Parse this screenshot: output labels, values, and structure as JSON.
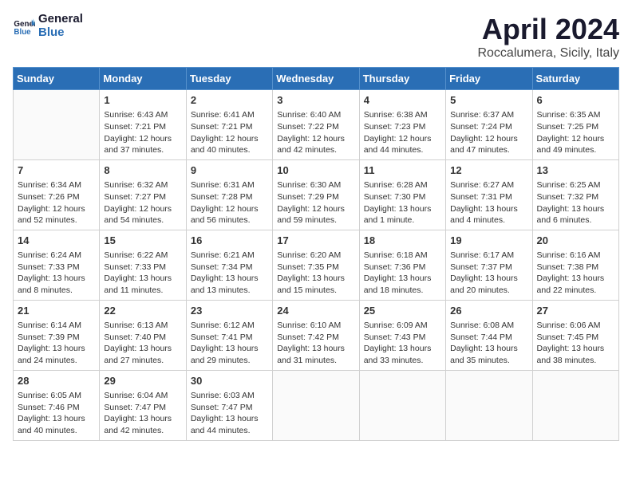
{
  "header": {
    "logo_line1": "General",
    "logo_line2": "Blue",
    "title": "April 2024",
    "subtitle": "Roccalumera, Sicily, Italy"
  },
  "columns": [
    "Sunday",
    "Monday",
    "Tuesday",
    "Wednesday",
    "Thursday",
    "Friday",
    "Saturday"
  ],
  "weeks": [
    [
      {
        "day": "",
        "sunrise": "",
        "sunset": "",
        "daylight": ""
      },
      {
        "day": "1",
        "sunrise": "Sunrise: 6:43 AM",
        "sunset": "Sunset: 7:21 PM",
        "daylight": "Daylight: 12 hours and 37 minutes."
      },
      {
        "day": "2",
        "sunrise": "Sunrise: 6:41 AM",
        "sunset": "Sunset: 7:21 PM",
        "daylight": "Daylight: 12 hours and 40 minutes."
      },
      {
        "day": "3",
        "sunrise": "Sunrise: 6:40 AM",
        "sunset": "Sunset: 7:22 PM",
        "daylight": "Daylight: 12 hours and 42 minutes."
      },
      {
        "day": "4",
        "sunrise": "Sunrise: 6:38 AM",
        "sunset": "Sunset: 7:23 PM",
        "daylight": "Daylight: 12 hours and 44 minutes."
      },
      {
        "day": "5",
        "sunrise": "Sunrise: 6:37 AM",
        "sunset": "Sunset: 7:24 PM",
        "daylight": "Daylight: 12 hours and 47 minutes."
      },
      {
        "day": "6",
        "sunrise": "Sunrise: 6:35 AM",
        "sunset": "Sunset: 7:25 PM",
        "daylight": "Daylight: 12 hours and 49 minutes."
      }
    ],
    [
      {
        "day": "7",
        "sunrise": "Sunrise: 6:34 AM",
        "sunset": "Sunset: 7:26 PM",
        "daylight": "Daylight: 12 hours and 52 minutes."
      },
      {
        "day": "8",
        "sunrise": "Sunrise: 6:32 AM",
        "sunset": "Sunset: 7:27 PM",
        "daylight": "Daylight: 12 hours and 54 minutes."
      },
      {
        "day": "9",
        "sunrise": "Sunrise: 6:31 AM",
        "sunset": "Sunset: 7:28 PM",
        "daylight": "Daylight: 12 hours and 56 minutes."
      },
      {
        "day": "10",
        "sunrise": "Sunrise: 6:30 AM",
        "sunset": "Sunset: 7:29 PM",
        "daylight": "Daylight: 12 hours and 59 minutes."
      },
      {
        "day": "11",
        "sunrise": "Sunrise: 6:28 AM",
        "sunset": "Sunset: 7:30 PM",
        "daylight": "Daylight: 13 hours and 1 minute."
      },
      {
        "day": "12",
        "sunrise": "Sunrise: 6:27 AM",
        "sunset": "Sunset: 7:31 PM",
        "daylight": "Daylight: 13 hours and 4 minutes."
      },
      {
        "day": "13",
        "sunrise": "Sunrise: 6:25 AM",
        "sunset": "Sunset: 7:32 PM",
        "daylight": "Daylight: 13 hours and 6 minutes."
      }
    ],
    [
      {
        "day": "14",
        "sunrise": "Sunrise: 6:24 AM",
        "sunset": "Sunset: 7:33 PM",
        "daylight": "Daylight: 13 hours and 8 minutes."
      },
      {
        "day": "15",
        "sunrise": "Sunrise: 6:22 AM",
        "sunset": "Sunset: 7:33 PM",
        "daylight": "Daylight: 13 hours and 11 minutes."
      },
      {
        "day": "16",
        "sunrise": "Sunrise: 6:21 AM",
        "sunset": "Sunset: 7:34 PM",
        "daylight": "Daylight: 13 hours and 13 minutes."
      },
      {
        "day": "17",
        "sunrise": "Sunrise: 6:20 AM",
        "sunset": "Sunset: 7:35 PM",
        "daylight": "Daylight: 13 hours and 15 minutes."
      },
      {
        "day": "18",
        "sunrise": "Sunrise: 6:18 AM",
        "sunset": "Sunset: 7:36 PM",
        "daylight": "Daylight: 13 hours and 18 minutes."
      },
      {
        "day": "19",
        "sunrise": "Sunrise: 6:17 AM",
        "sunset": "Sunset: 7:37 PM",
        "daylight": "Daylight: 13 hours and 20 minutes."
      },
      {
        "day": "20",
        "sunrise": "Sunrise: 6:16 AM",
        "sunset": "Sunset: 7:38 PM",
        "daylight": "Daylight: 13 hours and 22 minutes."
      }
    ],
    [
      {
        "day": "21",
        "sunrise": "Sunrise: 6:14 AM",
        "sunset": "Sunset: 7:39 PM",
        "daylight": "Daylight: 13 hours and 24 minutes."
      },
      {
        "day": "22",
        "sunrise": "Sunrise: 6:13 AM",
        "sunset": "Sunset: 7:40 PM",
        "daylight": "Daylight: 13 hours and 27 minutes."
      },
      {
        "day": "23",
        "sunrise": "Sunrise: 6:12 AM",
        "sunset": "Sunset: 7:41 PM",
        "daylight": "Daylight: 13 hours and 29 minutes."
      },
      {
        "day": "24",
        "sunrise": "Sunrise: 6:10 AM",
        "sunset": "Sunset: 7:42 PM",
        "daylight": "Daylight: 13 hours and 31 minutes."
      },
      {
        "day": "25",
        "sunrise": "Sunrise: 6:09 AM",
        "sunset": "Sunset: 7:43 PM",
        "daylight": "Daylight: 13 hours and 33 minutes."
      },
      {
        "day": "26",
        "sunrise": "Sunrise: 6:08 AM",
        "sunset": "Sunset: 7:44 PM",
        "daylight": "Daylight: 13 hours and 35 minutes."
      },
      {
        "day": "27",
        "sunrise": "Sunrise: 6:06 AM",
        "sunset": "Sunset: 7:45 PM",
        "daylight": "Daylight: 13 hours and 38 minutes."
      }
    ],
    [
      {
        "day": "28",
        "sunrise": "Sunrise: 6:05 AM",
        "sunset": "Sunset: 7:46 PM",
        "daylight": "Daylight: 13 hours and 40 minutes."
      },
      {
        "day": "29",
        "sunrise": "Sunrise: 6:04 AM",
        "sunset": "Sunset: 7:47 PM",
        "daylight": "Daylight: 13 hours and 42 minutes."
      },
      {
        "day": "30",
        "sunrise": "Sunrise: 6:03 AM",
        "sunset": "Sunset: 7:47 PM",
        "daylight": "Daylight: 13 hours and 44 minutes."
      },
      {
        "day": "",
        "sunrise": "",
        "sunset": "",
        "daylight": ""
      },
      {
        "day": "",
        "sunrise": "",
        "sunset": "",
        "daylight": ""
      },
      {
        "day": "",
        "sunrise": "",
        "sunset": "",
        "daylight": ""
      },
      {
        "day": "",
        "sunrise": "",
        "sunset": "",
        "daylight": ""
      }
    ]
  ]
}
